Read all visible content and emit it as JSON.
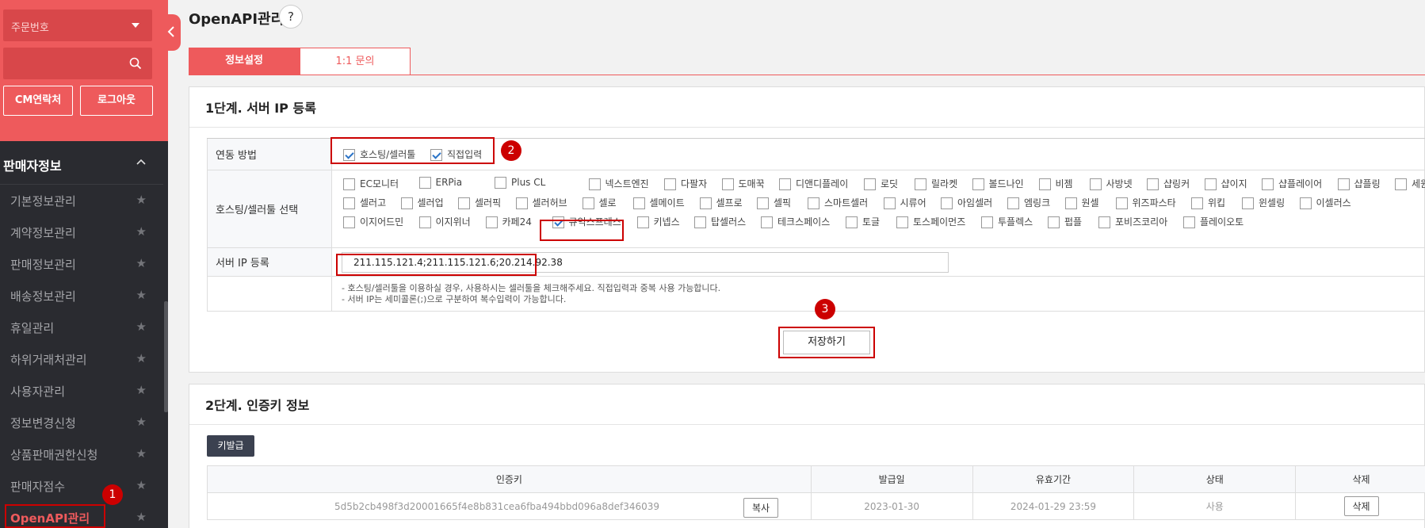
{
  "sidebar": {
    "order_select": "주문번호",
    "cm_button": "CM연락처",
    "logout_button": "로그아웃",
    "section_title": "판매자정보",
    "items": [
      {
        "label": "기본정보관리"
      },
      {
        "label": "계약정보관리"
      },
      {
        "label": "판매정보관리"
      },
      {
        "label": "배송정보관리"
      },
      {
        "label": "휴일관리"
      },
      {
        "label": "하위거래처관리"
      },
      {
        "label": "사용자관리"
      },
      {
        "label": "정보변경신청"
      },
      {
        "label": "상품판매권한신청"
      },
      {
        "label": "판매자점수"
      },
      {
        "label": "OpenAPI관리"
      }
    ]
  },
  "header": {
    "title": "OpenAPI관리",
    "help": "?"
  },
  "tabs": [
    {
      "label": "정보설정"
    },
    {
      "label": "1:1 문의"
    }
  ],
  "step1": {
    "title": "1단계. 서버 IP 등록",
    "method_label": "연동 방법",
    "method_options": [
      {
        "label": "호스팅/셀러툴"
      },
      {
        "label": "직접입력"
      }
    ],
    "hosting_label": "호스팅/셀러툴 선택",
    "hosting_rows": [
      [
        "EC모니터",
        "ERPia",
        "Plus CL",
        "넥스트엔진",
        "다팔자",
        "도매꾹",
        "디앤디플레이",
        "로딧",
        "릴라켓",
        "볼드나인",
        "비젬",
        "사방넷",
        "샵링커",
        "샵이지",
        "샵플레이어",
        "샵플링",
        "세원설링"
      ],
      [
        "셀러고",
        "셀러업",
        "셀러픽",
        "셀러허브",
        "셀로",
        "셀메이트",
        "셀프로",
        "셀픽",
        "스마트셀러",
        "시류어",
        "아임셀러",
        "엠링크",
        "원셀",
        "위즈파스타",
        "위킵",
        "윈셀링",
        "이셀러스"
      ],
      [
        "이지어드민",
        "이지위너",
        "카페24",
        "큐익스프레스",
        "키넵스",
        "탑셀러스",
        "테크스페이스",
        "토글",
        "토스페이먼즈",
        "투플렉스",
        "펍플",
        "포비즈코리아",
        "플레이오토"
      ]
    ],
    "checked_hosting": "큐익스프레스",
    "ip_label": "서버 IP 등록",
    "ip_value": "211.115.121.4;211.115.121.6;20.214.92.38",
    "notes": [
      "- 호스팅/셀러툴을 이용하실 경우, 사용하시는 셀러툴을 체크해주세요. 직접입력과 중복 사용 가능합니다.",
      "- 서버 IP는 세미콜론(;)으로 구분하여 복수입력이 가능합니다."
    ],
    "save_button": "저장하기"
  },
  "step2": {
    "title": "2단계. 인증키 정보",
    "issue_button": "키발급",
    "columns": [
      "인증키",
      "발급일",
      "유효기간",
      "상태",
      "삭제"
    ],
    "rows": [
      {
        "key": "5d5b2cb498f3d20001665f4e8b831cea6fba494bbd096a8def346039",
        "copy": "복사",
        "issued": "2023-01-30",
        "expires": "2024-01-29 23:59",
        "status": "사용",
        "delete": "삭제"
      }
    ]
  },
  "annotations": [
    "1",
    "2",
    "3"
  ],
  "colors": {
    "accent": "#ee5a5c",
    "sidebar": "#2a2b30",
    "annotation": "#cc0000"
  }
}
